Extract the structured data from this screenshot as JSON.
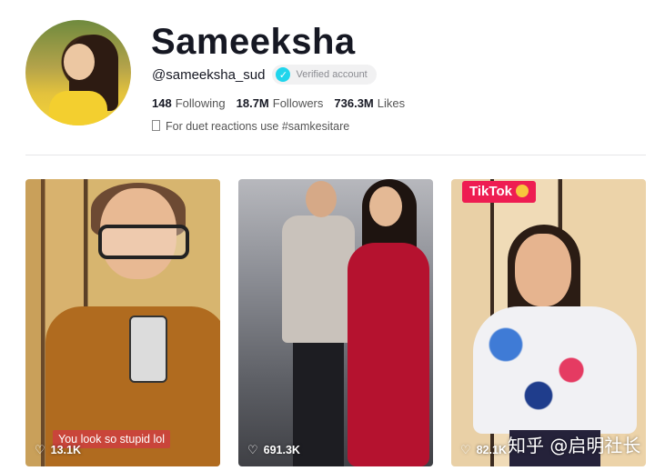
{
  "profile": {
    "name": "Sameeksha",
    "handle": "@sameeksha_sud",
    "verified_label": "Verified account",
    "following_count": "148",
    "following_label": "Following",
    "followers_count": "18.7M",
    "followers_label": "Followers",
    "likes_count": "736.3M",
    "likes_label": "Likes",
    "bio": "For duet reactions use #samkesitare"
  },
  "videos": [
    {
      "caption": "You look so stupid lol",
      "views": "13.1K"
    },
    {
      "views": "691.3K"
    },
    {
      "badge": "TikTok",
      "views": "82.1K"
    }
  ],
  "watermark": "知乎 @启明社长",
  "colors": {
    "accent": "#ee1d52",
    "verified": "#20d5ec"
  }
}
